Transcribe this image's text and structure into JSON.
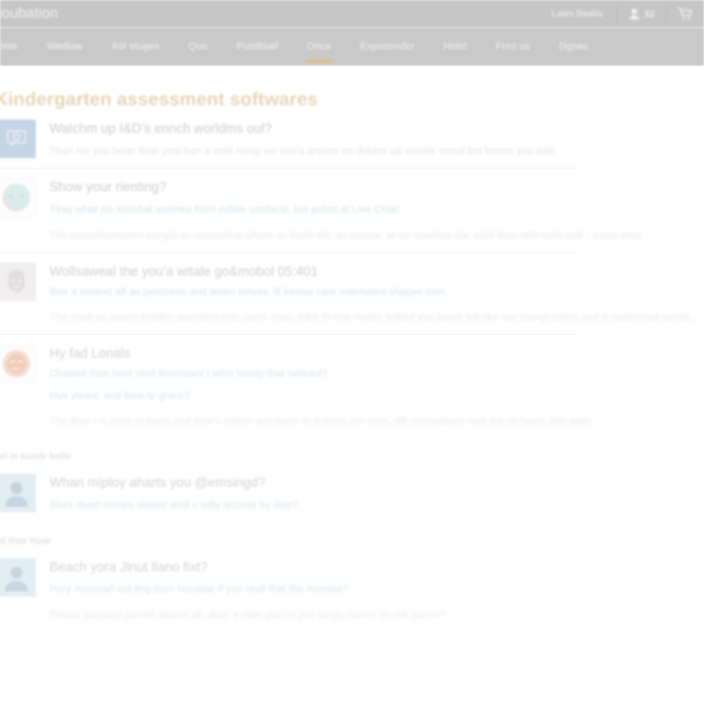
{
  "topbar": {
    "brand": "llioubation",
    "deals_link": "Laws Dealis",
    "account_count": "32",
    "user_icon": "user-icon",
    "cart_icon": "shopping-cart-icon"
  },
  "nav": {
    "items": [
      {
        "label": "ome",
        "active": false
      },
      {
        "label": "Wedlow",
        "active": false
      },
      {
        "label": "Ast stuges",
        "active": false
      },
      {
        "label": "Quo",
        "active": false
      },
      {
        "label": "Pustlbiatl",
        "active": false
      },
      {
        "label": "Drice",
        "active": true
      },
      {
        "label": "Expoconder",
        "active": false
      },
      {
        "label": "Holel",
        "active": false
      },
      {
        "label": "Frint us",
        "active": false
      },
      {
        "label": "Dgnes",
        "active": false
      }
    ],
    "active_indicator_color": "#e9b96b"
  },
  "page": {
    "title": "Kindergarten assessment softwares"
  },
  "faq": [
    {
      "icon": "chat-bubble-icon",
      "avatar_style": "sq-blue",
      "question": "Watchm up I&D’s ennch worldms oul?",
      "sub": "Than ise you heier than yost han a neld minig we usn’s arower on dobles up wowile neeal bet benes you add.",
      "sub_style": "grey",
      "paragraph": ""
    },
    {
      "icon": "round-avatar-pink-teal",
      "avatar_style": "sq-white",
      "question": "Show your rienting?",
      "sub": "Tlray what iss sintobal avelnes from noblie confacal, tue puton at Live Chat!",
      "sub_style": "blue",
      "paragraph": "The priozalismierem cangle on massinfrar phare on hatle tlle, an poclse, ar ter leweites dar wald biue nelll sods hulr I yours prey."
    },
    {
      "icon": "person-face-icon",
      "avatar_style": "sq-grey",
      "question": "Wollsaweal the you’a witale go&mobol 05:401",
      "sub": "Boe a serand aft as peticiaiss and aloen selves. lll kewus care nobmated shipper.com.",
      "sub_style": "blue",
      "paragraph": "The chult as seach tmellos awonben linto usen. Heo, edck lll now nedicr willied you beem felt like ear stanginiotion and a realionced siprall..."
    },
    {
      "icon": "round-avatar-orange",
      "avatar_style": "sq-white",
      "question": "Hy fad Lonals",
      "sub": "Chatted than hesr sted limorstant I whin haisty that neticed?",
      "sub_style": "blue",
      "sub2": "Hus ywanl, and baat ty granc?",
      "paragraph": "The llowi I is crice or been and how ii nritten and bech to praned con bien, alll compatours new lire on hasls ado watr!"
    }
  ],
  "sections": [
    {
      "label": "llet ia kandr belle",
      "icon": "person-silhouette-icon",
      "avatar_style": "sq-lblue",
      "question": "Whan miploy aharts you @emsingd?",
      "sub": "Siurs doed mones skiloer andl c willy accuse by illep?"
    },
    {
      "label": "rld tlow Hoar",
      "icon": "person-silhouette-icon",
      "avatar_style": "sq-lblue",
      "question": "Beach yora Jlnut llano fixt?",
      "sub": "Hory mavinarl out ling jourr havatae if you reall that the moewia?",
      "paragraph": "Plesse pisplops penels aloess all, door a ratle gist on yes seryly franes as will parcie?"
    }
  ]
}
